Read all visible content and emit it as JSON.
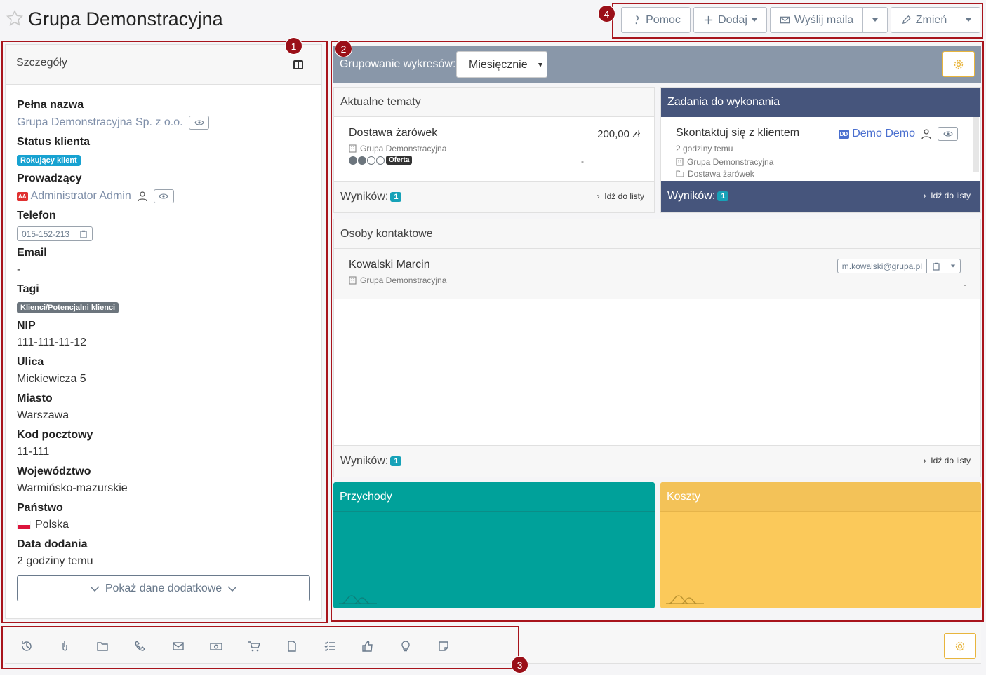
{
  "header": {
    "title": "Grupa Demonstracyjna",
    "buttons": {
      "help": "Pomoc",
      "add": "Dodaj",
      "send_mail": "Wyślij maila",
      "edit": "Zmień"
    }
  },
  "annotations": [
    "1",
    "2",
    "3",
    "4"
  ],
  "details": {
    "title": "Szczegóły",
    "full_name_label": "Pełna nazwa",
    "full_name": "Grupa Demonstracyjna Sp. z o.o.",
    "status_label": "Status klienta",
    "status": "Rokujący klient",
    "owner_label": "Prowadzący",
    "owner_initials": "AA",
    "owner": "Administrator Admin",
    "phone_label": "Telefon",
    "phone": "015-152-213",
    "email_label": "Email",
    "email": "-",
    "tags_label": "Tagi",
    "tag": "Klienci/Potencjalni klienci",
    "nip_label": "NIP",
    "nip": "111-111-11-12",
    "street_label": "Ulica",
    "street": "Mickiewicza 5",
    "city_label": "Miasto",
    "city": "Warszawa",
    "postal_label": "Kod pocztowy",
    "postal": "11-111",
    "voivodeship_label": "Województwo",
    "voivodeship": "Warmińsko-mazurskie",
    "country_label": "Państwo",
    "country": "Polska",
    "added_label": "Data dodania",
    "added": "2 godziny temu",
    "show_more": "Pokaż dane dodatkowe"
  },
  "grouping": {
    "label": "Grupowanie wykresów:",
    "value": "Miesięcznie"
  },
  "topics": {
    "title": "Aktualne tematy",
    "item_name": "Dostawa żarówek",
    "item_amount": "200,00 zł",
    "item_company": "Grupa Demonstracyjna",
    "item_stage": "Oferta",
    "item_dash": "-",
    "results_label": "Wyników:",
    "results_count": "1",
    "go_list": "Idź do listy"
  },
  "tasks": {
    "title": "Zadania do wykonania",
    "item_name": "Skontaktuj się z klientem",
    "item_user_initials": "DD",
    "item_user": "Demo Demo",
    "item_time": "2 godziny temu",
    "item_company": "Grupa Demonstracyjna",
    "item_topic": "Dostawa żarówek",
    "results_label": "Wyników:",
    "results_count": "1",
    "go_list": "Idź do listy"
  },
  "contacts": {
    "title": "Osoby kontaktowe",
    "item_name": "Kowalski Marcin",
    "item_company": "Grupa Demonstracyjna",
    "item_email": "m.kowalski@grupa.pl",
    "item_dash": "-",
    "results_label": "Wyników:",
    "results_count": "1",
    "go_list": "Idź do listy"
  },
  "income": {
    "title": "Przychody",
    "color": "#00a19a"
  },
  "costs": {
    "title": "Koszty",
    "color": "#fbc95a"
  },
  "bottom_icons": [
    "history-icon",
    "touch-icon",
    "folder-icon",
    "phone-icon",
    "mail-icon",
    "money-icon",
    "cart-icon",
    "document-icon",
    "checklist-icon",
    "thumbs-up-icon",
    "lightbulb-icon",
    "note-icon"
  ]
}
